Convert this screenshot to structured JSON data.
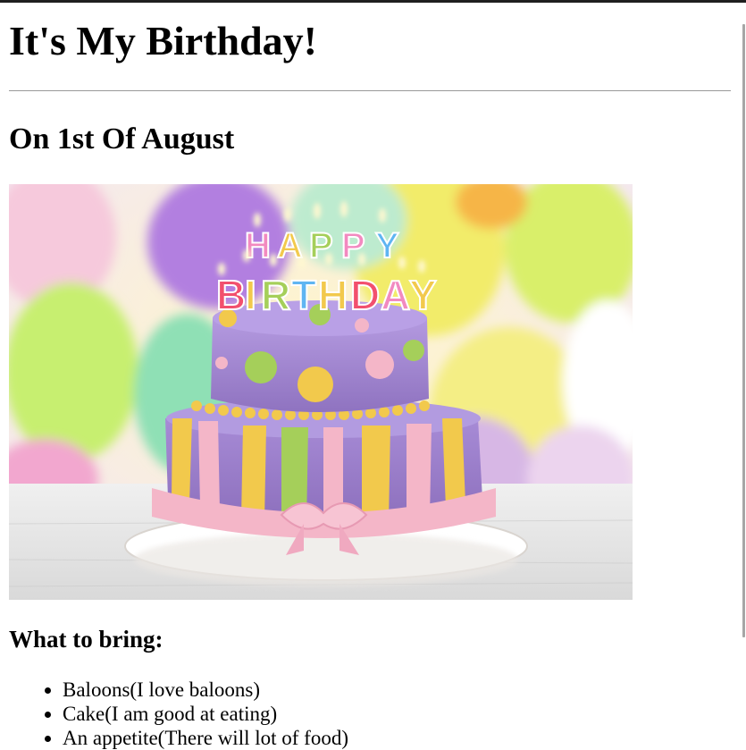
{
  "page": {
    "title": "It's My Birthday!",
    "date_heading": "On 1st Of August",
    "image_caption_text": "HAPPY BIRTHDAY",
    "bring_heading": "What to bring:",
    "bring_items": [
      "Baloons(I love baloons)",
      "Cake(I am good at eating)",
      "An appetite(There will lot of food)"
    ]
  },
  "colors": {
    "text": "#000000",
    "rule": "#9a9a9a",
    "cake_purple": "#9b7fc9",
    "ribbon_pink": "#f4b6c8",
    "accent_yellow": "#f2c94c",
    "accent_green": "#a5cf5a"
  },
  "icons": {
    "list_bullet": "disc"
  }
}
